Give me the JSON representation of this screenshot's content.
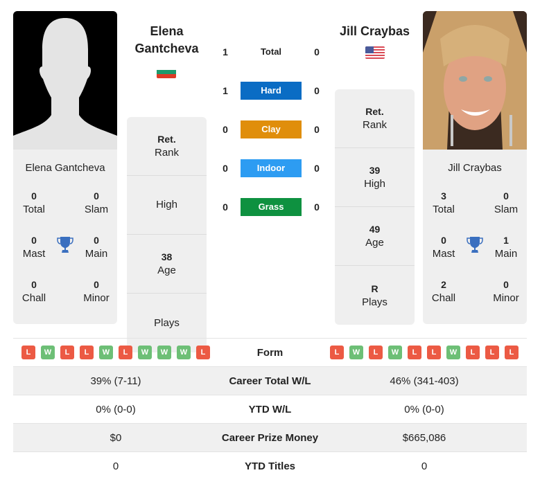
{
  "players": [
    {
      "name": "Elena Gantcheva",
      "title_lines": [
        "Elena",
        "Gantcheva"
      ],
      "flag": "bulgaria-flag",
      "photo": "silhouette-placeholder",
      "titles": {
        "total": {
          "value": "0",
          "label": "Total"
        },
        "slam": {
          "value": "0",
          "label": "Slam"
        },
        "mast": {
          "value": "0",
          "label": "Mast"
        },
        "main": {
          "value": "0",
          "label": "Main"
        },
        "chall": {
          "value": "0",
          "label": "Chall"
        },
        "minor": {
          "value": "0",
          "label": "Minor"
        }
      },
      "stats": [
        {
          "value": "Ret.",
          "label": "Rank"
        },
        {
          "value": "",
          "label": "High"
        },
        {
          "value": "38",
          "label": "Age"
        },
        {
          "value": "",
          "label": "Plays"
        }
      ],
      "form": [
        "L",
        "W",
        "L",
        "L",
        "W",
        "L",
        "W",
        "W",
        "W",
        "L"
      ],
      "career_wl": "39% (7-11)",
      "ytd_wl": "0% (0-0)",
      "prize_money": "$0",
      "ytd_titles": "0"
    },
    {
      "name": "Jill Craybas",
      "title_lines": [
        "Jill Craybas"
      ],
      "flag": "usa-flag",
      "photo": "player-photo",
      "titles": {
        "total": {
          "value": "3",
          "label": "Total"
        },
        "slam": {
          "value": "0",
          "label": "Slam"
        },
        "mast": {
          "value": "0",
          "label": "Mast"
        },
        "main": {
          "value": "1",
          "label": "Main"
        },
        "chall": {
          "value": "2",
          "label": "Chall"
        },
        "minor": {
          "value": "0",
          "label": "Minor"
        }
      },
      "stats": [
        {
          "value": "Ret.",
          "label": "Rank"
        },
        {
          "value": "39",
          "label": "High"
        },
        {
          "value": "49",
          "label": "Age"
        },
        {
          "value": "R",
          "label": "Plays"
        }
      ],
      "form": [
        "L",
        "W",
        "L",
        "W",
        "L",
        "L",
        "W",
        "L",
        "L",
        "L"
      ],
      "career_wl": "46% (341-403)",
      "ytd_wl": "0% (0-0)",
      "prize_money": "$665,086",
      "ytd_titles": "0"
    }
  ],
  "h2h": [
    {
      "label": "Total",
      "left": "1",
      "right": "0",
      "color": ""
    },
    {
      "label": "Hard",
      "left": "1",
      "right": "0",
      "color": "#0a6cc4"
    },
    {
      "label": "Clay",
      "left": "0",
      "right": "0",
      "color": "#e08e0b"
    },
    {
      "label": "Indoor",
      "left": "0",
      "right": "0",
      "color": "#2d9cf2"
    },
    {
      "label": "Grass",
      "left": "0",
      "right": "0",
      "color": "#0e9140"
    }
  ],
  "comparison_labels": {
    "form": "Form",
    "career_wl": "Career Total W/L",
    "ytd_wl": "YTD W/L",
    "prize_money": "Career Prize Money",
    "ytd_titles": "YTD Titles"
  },
  "colors": {
    "loss": "#ec5a44",
    "win": "#6dbf76",
    "trophy": "#3a6fbf"
  }
}
